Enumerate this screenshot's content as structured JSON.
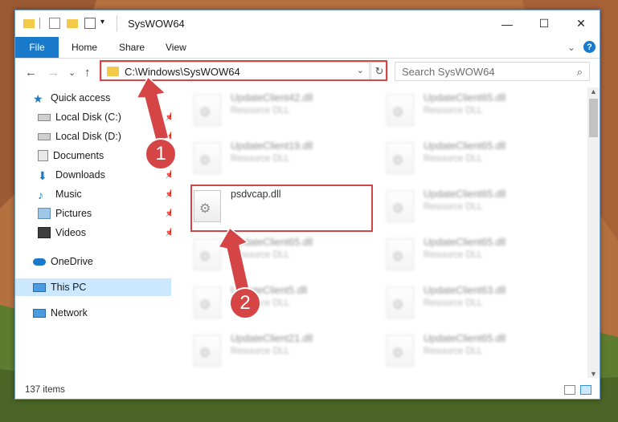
{
  "window": {
    "title": "SysWOW64",
    "minimize": "—",
    "maximize": "☐",
    "close": "✕"
  },
  "ribbon": {
    "tabs": [
      "File",
      "Home",
      "Share",
      "View"
    ],
    "help": "?",
    "expand": "⌄"
  },
  "nav": {
    "back": "←",
    "forward": "→",
    "recent": "⌄",
    "up": "↑",
    "address": "C:\\Windows\\SysWOW64",
    "address_chevron": "⌄",
    "refresh": "↻",
    "search_placeholder": "Search SysWOW64",
    "search_icon": "⌕"
  },
  "sidebar": {
    "items": [
      {
        "label": "Quick access",
        "icon": "star-icon"
      },
      {
        "label": "Local Disk (C:)",
        "icon": "drive-icon",
        "pinned": true
      },
      {
        "label": "Local Disk (D:)",
        "icon": "drive-icon",
        "pinned": true
      },
      {
        "label": "Documents",
        "icon": "documents-icon",
        "pinned": true
      },
      {
        "label": "Downloads",
        "icon": "download-icon",
        "pinned": true
      },
      {
        "label": "Music",
        "icon": "music-icon",
        "pinned": true
      },
      {
        "label": "Pictures",
        "icon": "pictures-icon",
        "pinned": true
      },
      {
        "label": "Videos",
        "icon": "videos-icon",
        "pinned": true
      },
      {
        "label": "OneDrive",
        "icon": "cloud-icon"
      },
      {
        "label": "This PC",
        "icon": "computer-icon",
        "selected": true
      },
      {
        "label": "Network",
        "icon": "network-icon"
      }
    ]
  },
  "files": {
    "left": [
      {
        "name": "UpdateClient42.dll",
        "type": "Resource DLL"
      },
      {
        "name": "UpdateClient19.dll",
        "type": "Resource DLL"
      },
      {
        "name": "psdvcap.dll",
        "type": ""
      },
      {
        "name": "UpdateClient65.dll",
        "type": "Resource DLL"
      },
      {
        "name": "UpdateClient5.dll",
        "type": "Resource DLL"
      },
      {
        "name": "UpdateClient21.dll",
        "type": "Resource DLL"
      }
    ],
    "right": [
      {
        "name": "UpdateClient65.dll",
        "type": "Resource DLL"
      },
      {
        "name": "UpdateClient65.dll",
        "type": "Resource DLL"
      },
      {
        "name": "UpdateClient65.dll",
        "type": "Resource DLL"
      },
      {
        "name": "UpdateClient65.dll",
        "type": "Resource DLL"
      },
      {
        "name": "UpdateClient63.dll",
        "type": "Resource DLL"
      },
      {
        "name": "UpdateClient65.dll",
        "type": "Resource DLL"
      }
    ]
  },
  "status": {
    "items_count": "137 items"
  },
  "annotations": {
    "badge1": "1",
    "badge2": "2",
    "color": "#d64545"
  }
}
